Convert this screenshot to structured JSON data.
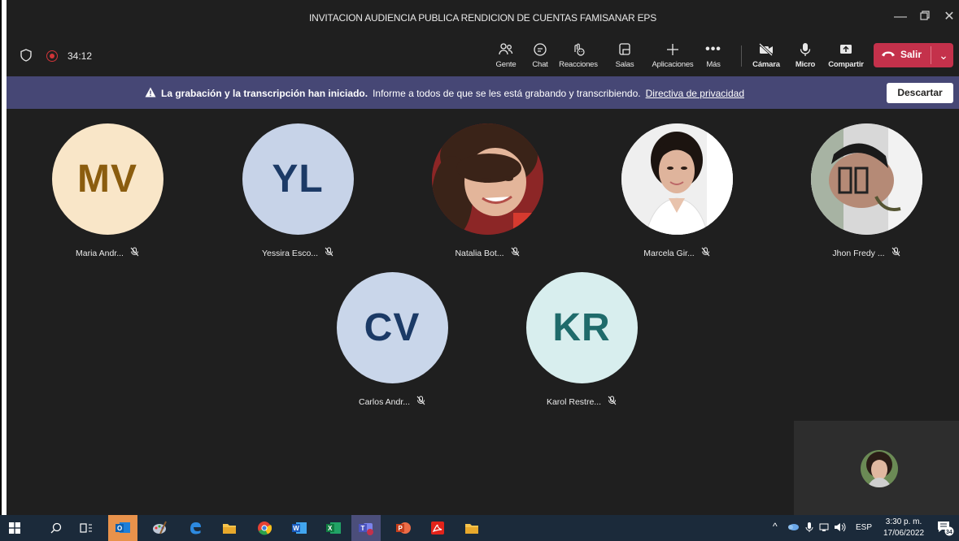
{
  "window": {
    "title": "INVITACION AUDIENCIA PUBLICA RENDICION DE CUENTAS FAMISANAR EPS"
  },
  "toolbar": {
    "timer": "34:12",
    "people_label": "Gente",
    "chat_label": "Chat",
    "reactions_label": "Reacciones",
    "rooms_label": "Salas",
    "apps_label": "Aplicaciones",
    "more_label": "Más",
    "camera_label": "Cámara",
    "mic_label": "Micro",
    "share_label": "Compartir",
    "leave_label": "Salir"
  },
  "banner": {
    "bold_text": "La grabación y la transcripción han iniciado.",
    "text": "Informe a todos de que se les está grabando y transcribiendo.",
    "link_text": "Directiva de privacidad",
    "dismiss_label": "Descartar"
  },
  "participants": [
    {
      "name": "Maria Andr...",
      "initials": "MV",
      "bg": "#f9e6c8",
      "fg": "#8b5d0f",
      "photo": false
    },
    {
      "name": "Yessira Esco...",
      "initials": "YL",
      "bg": "#c7d3e8",
      "fg": "#1c3a66",
      "photo": false
    },
    {
      "name": "Natalia Bot...",
      "initials": "",
      "photo": true
    },
    {
      "name": "Marcela Gir...",
      "initials": "",
      "photo": true
    },
    {
      "name": "Jhon Fredy ...",
      "initials": "",
      "photo": true
    },
    {
      "name": "Carlos Andr...",
      "initials": "CV",
      "bg": "#c9d6ea",
      "fg": "#1b3a66",
      "photo": false
    },
    {
      "name": "Karol Restre...",
      "initials": "KR",
      "bg": "#d8eeee",
      "fg": "#1f6b6b",
      "photo": false
    }
  ],
  "taskbar": {
    "language": "ESP",
    "time": "3:30 p. m.",
    "date": "17/06/2022",
    "notification_count": "34"
  },
  "colors": {
    "app_bg": "#1f1f1f",
    "banner_bg": "#464775",
    "leave_red": "#c4314b",
    "recording_red": "#d13438"
  }
}
